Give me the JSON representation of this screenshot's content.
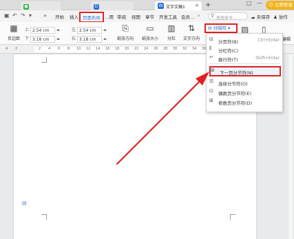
{
  "titlebar": {
    "doc_tab_label": "文字文稿1",
    "doc_tab_icon": "W",
    "new_tab_label": "+",
    "upgrade_label": "立即登录",
    "window_controls": [
      "□",
      "—"
    ]
  },
  "menubar": {
    "items": [
      "开始",
      "插入",
      "页面布局",
      "…用",
      "审阅",
      "视图",
      "章节",
      "开发工具",
      "会员…"
    ],
    "active_item": "页面布局",
    "search_placeholder": "查找命令…",
    "sync_label": "未保存",
    "collab_label": "协作"
  },
  "ribbon": {
    "page_margin_label": "页边距",
    "margin_top_value": "2.54 cm",
    "margin_bottom_value": "3.18 cm",
    "margin_left_value": "2.54 cm",
    "margin_right_value": "3.18 cm",
    "orientation_label": "纸张方向",
    "size_label": "纸张大小",
    "columns_label": "分栏",
    "text_direction_label": "文字方向",
    "break_button_label": "分隔符",
    "right_label": "编辑"
  },
  "ruler": {
    "ticks": [
      "4",
      "2",
      "2",
      "4",
      "6",
      "8",
      "10",
      "12",
      "14",
      "16",
      "18",
      "20",
      "22",
      "24",
      "26",
      "28",
      "30",
      "32",
      "34",
      "36",
      "38"
    ]
  },
  "dropdown": {
    "items": [
      {
        "label": "分页符(B)",
        "shortcut": "Ctrl+Enter",
        "icon": "page-break-icon"
      },
      {
        "label": "分栏符(C)",
        "shortcut": "",
        "icon": "column-break-icon"
      },
      {
        "label": "换行符(T)",
        "shortcut": "Shift+Enter",
        "icon": "line-break-icon"
      },
      {
        "label": "下一页分节符(N)",
        "shortcut": "",
        "icon": "next-page-section-icon"
      },
      {
        "label": "连续分节符(O)",
        "shortcut": "",
        "icon": "continuous-section-icon"
      },
      {
        "label": "偶数页分节符(E)",
        "shortcut": "",
        "icon": "even-page-section-icon"
      },
      {
        "label": "奇数页分节符(D)",
        "shortcut": "",
        "icon": "odd-page-section-icon"
      }
    ],
    "highlighted_index": 3
  },
  "colors": {
    "annotation_red": "#e02020",
    "accent_blue": "#1e6bd6",
    "upgrade_orange": "#f0b41e"
  }
}
